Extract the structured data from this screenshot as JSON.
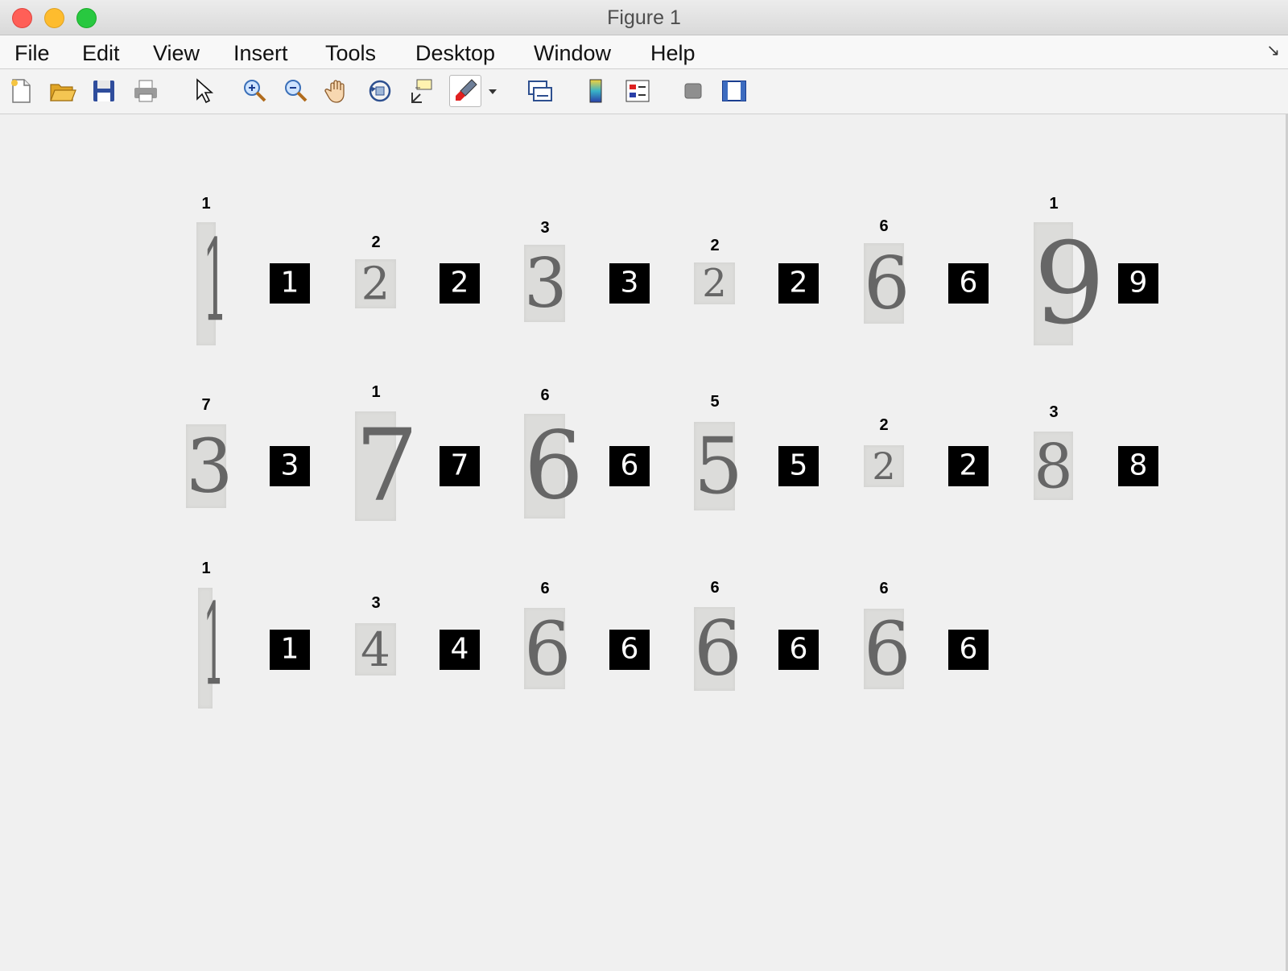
{
  "window": {
    "title": "Figure 1"
  },
  "menu": [
    "File",
    "Edit",
    "View",
    "Insert",
    "Tools",
    "Desktop",
    "Window",
    "Help"
  ],
  "toolbar": [
    "new-figure-icon",
    "open-file-icon",
    "save-icon",
    "print-icon",
    "select-arrow-icon",
    "zoom-in-icon",
    "zoom-out-icon",
    "pan-hand-icon",
    "rotate-3d-icon",
    "data-cursor-icon",
    "brush-icon",
    "brush-dropdown-icon",
    "link-plot-icon",
    "colorbar-icon",
    "legend-icon",
    "hide-plot-tools-icon",
    "show-plot-tools-icon"
  ],
  "grid": {
    "rows": [
      {
        "pairs": [
          {
            "label": "1",
            "digit": "1",
            "bw": "1"
          },
          {
            "label": "2",
            "digit": "2",
            "bw": "2"
          },
          {
            "label": "3",
            "digit": "3",
            "bw": "3"
          },
          {
            "label": "2",
            "digit": "2",
            "bw": "2"
          },
          {
            "label": "6",
            "digit": "6",
            "bw": "6"
          },
          {
            "label": "1",
            "digit": "9",
            "bw": "9"
          }
        ]
      },
      {
        "pairs": [
          {
            "label": "7",
            "digit": "3",
            "bw": "3"
          },
          {
            "label": "1",
            "digit": "7",
            "bw": "7"
          },
          {
            "label": "6",
            "digit": "6",
            "bw": "6"
          },
          {
            "label": "5",
            "digit": "5",
            "bw": "5"
          },
          {
            "label": "2",
            "digit": "2",
            "bw": "2"
          },
          {
            "label": "3",
            "digit": "8",
            "bw": "8"
          }
        ]
      },
      {
        "pairs": [
          {
            "label": "1",
            "digit": "1",
            "bw": "1"
          },
          {
            "label": "3",
            "digit": "4",
            "bw": "4"
          },
          {
            "label": "6",
            "digit": "6",
            "bw": "6"
          },
          {
            "label": "6",
            "digit": "6",
            "bw": "6"
          },
          {
            "label": "6",
            "digit": "6",
            "bw": "6"
          }
        ]
      }
    ]
  }
}
